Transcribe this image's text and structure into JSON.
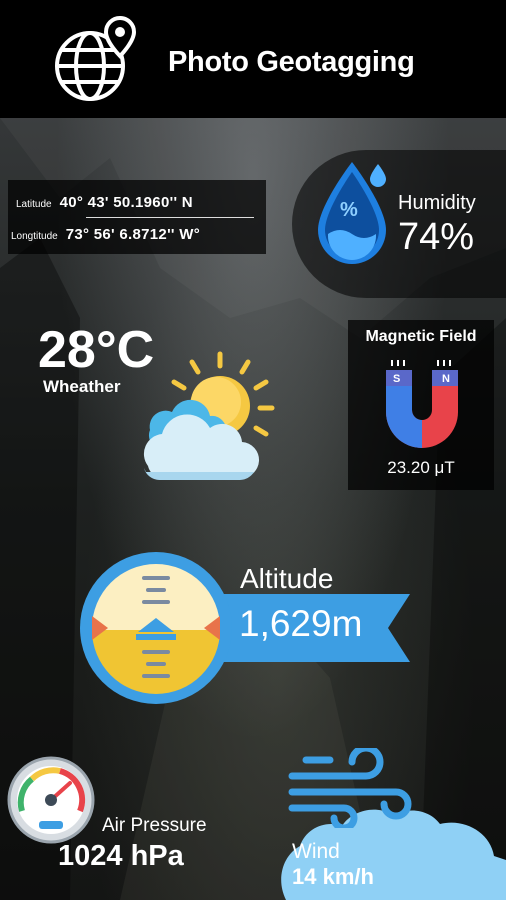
{
  "header": {
    "title": "Photo Geotagging"
  },
  "coordinates": {
    "latitude_label": "Latitude",
    "latitude_value": "40° 43' 50.1960'' N",
    "longitude_label": "Longtitude",
    "longitude_value": "73° 56' 6.8712'' W°"
  },
  "humidity": {
    "label": "Humidity",
    "value": "74%"
  },
  "weather": {
    "temperature": "28°C",
    "label": "Wheather"
  },
  "magnetic_field": {
    "title": "Magnetic Field",
    "value": "23.20 μT",
    "pole_south": "S",
    "pole_north": "N"
  },
  "altitude": {
    "label": "Altitude",
    "value": "1,629m"
  },
  "air_pressure": {
    "label": "Air Pressure",
    "value": "1024 hPa"
  },
  "wind": {
    "label": "Wind",
    "value": "14 km/h"
  },
  "colors": {
    "accent_blue": "#3d9ee3",
    "humidity_blue": "#1e7fe0",
    "sun": "#f5c842",
    "magnet_red": "#e8434a"
  }
}
